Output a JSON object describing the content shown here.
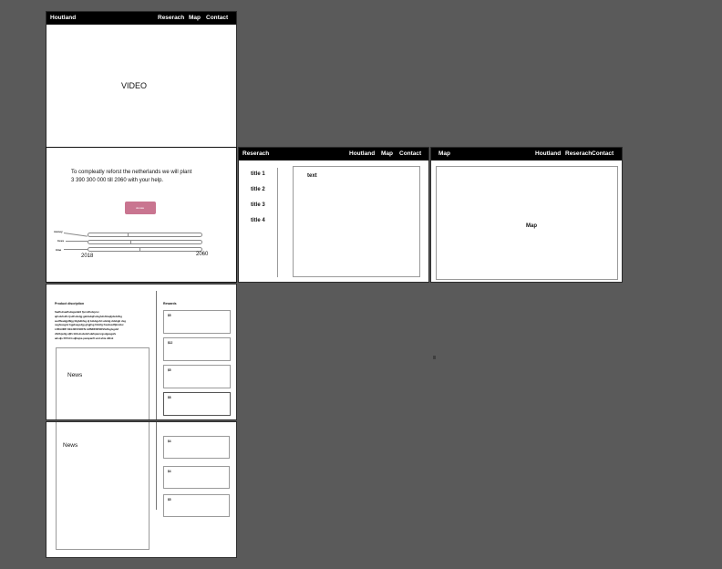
{
  "home": {
    "brand": "Houtland",
    "nav": [
      "Reserach",
      "Map",
      "Contact"
    ],
    "video_label": "VIDEO",
    "pitch": {
      "line1": "To compleatly reforst the netherlands we will plant",
      "line2": "3 390 300 000 till 2060 with your help.",
      "donate_label": "donate",
      "rows": [
        "money",
        "trees",
        "time"
      ],
      "progress": [
        0.35,
        0.37,
        0.45
      ],
      "year_start": "2018",
      "year_end": "2060"
    }
  },
  "research": {
    "brand": "Reserach",
    "nav": [
      "Houtland",
      "Map",
      "Contact"
    ],
    "titles": [
      "title 1",
      "title 2",
      "title 3",
      "title 4"
    ],
    "text_label": "text"
  },
  "map_page": {
    "brand": "Map",
    "nav": [
      "Houtland",
      "Reserach",
      "Contact"
    ],
    "map_label": "Map"
  },
  "product": {
    "desc_heading": "Product discription",
    "desc_lines": [
      "Sadfsdsadfsdagsdafd fjsrvdfsdsjvsx",
      "ajfsdsfsdfs ljsdfsdsdjg galdsdajfsdsghdsfdsajljdsdsfbg",
      "asdffsadgjdfkjg fdghdkfsg dj bdsbgsfd sdsldg ddsbgh dsg",
      "sagfsasgdv bgjdsagsdjg ghgjfsg fdsbfg Fasdasdfjkmdsx",
      "LRKLNRF KELNR KSDFN LMNDFNFSDSSdfsglsgdsf",
      "dfsfbjsdlg afjfv bfdsdsdsdvfsdafsjaxcvgsdgasgafs",
      "adsdjs FFFH hsdjhajva parapanfl und ahte dillsti"
    ],
    "news_label": "News",
    "rewards_heading": "Rewards",
    "rewards": [
      "$5",
      "$12",
      "$5",
      "$8"
    ]
  },
  "product2": {
    "news_label": "News",
    "rewards": [
      "$4",
      "$4",
      "$5"
    ]
  }
}
